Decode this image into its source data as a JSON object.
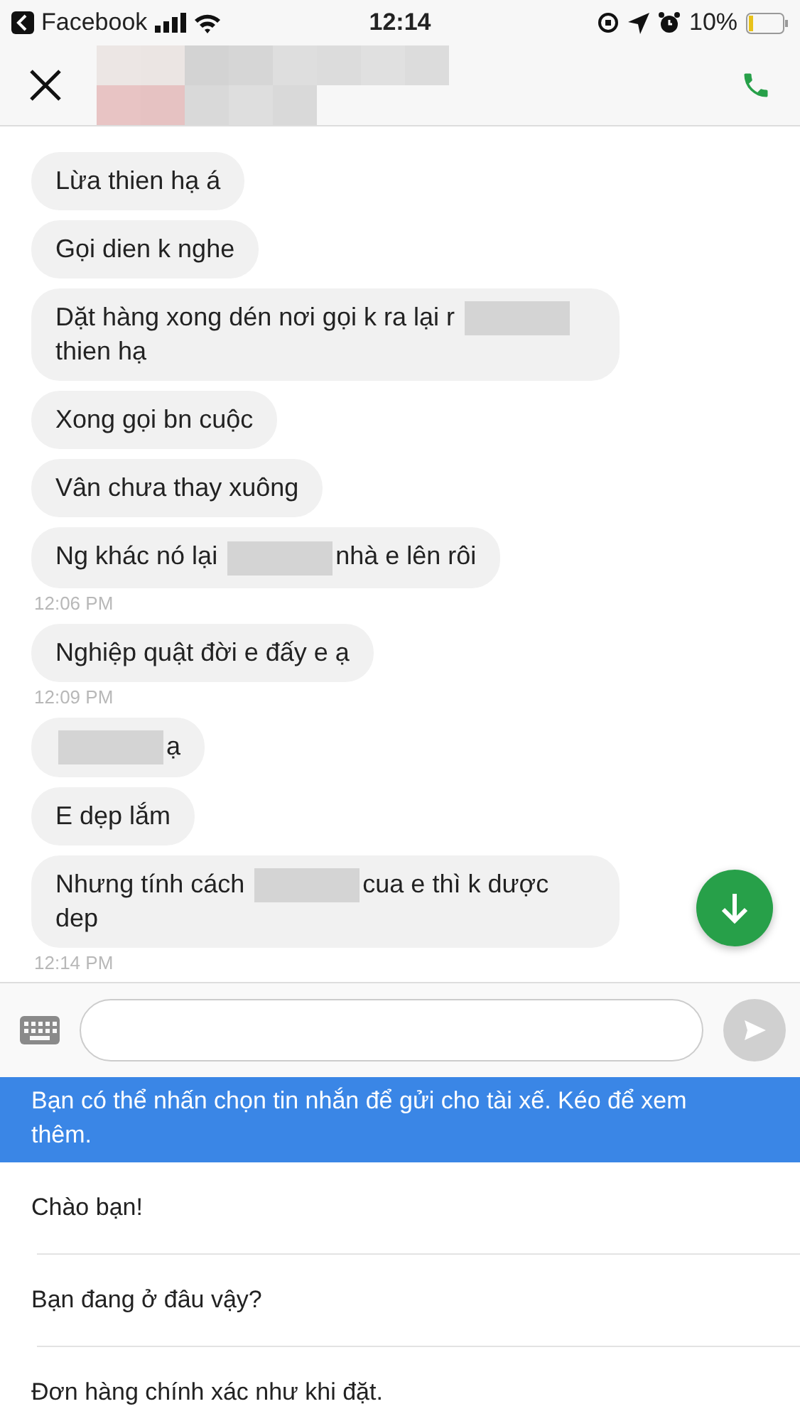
{
  "status_bar": {
    "back_app": "Facebook",
    "time": "12:14",
    "battery": "10%"
  },
  "messages": [
    {
      "kind": "message",
      "parts": [
        {
          "kind": "text",
          "text": "Lừa thien hạ á"
        }
      ]
    },
    {
      "kind": "message",
      "parts": [
        {
          "kind": "text",
          "text": "Gọi dien k nghe"
        }
      ]
    },
    {
      "kind": "message",
      "parts": [
        {
          "kind": "text",
          "text": "Dặt hàng xong dén nơi gọi k ra lại r"
        },
        {
          "kind": "redacted"
        },
        {
          "kind": "text",
          "text": "thien hạ"
        }
      ]
    },
    {
      "kind": "message",
      "parts": [
        {
          "kind": "text",
          "text": "Xong gọi bn cuộc"
        }
      ]
    },
    {
      "kind": "message",
      "parts": [
        {
          "kind": "text",
          "text": "Vân chưa thay xuông"
        }
      ]
    },
    {
      "kind": "message",
      "parts": [
        {
          "kind": "text",
          "text": "Ng khác nó lại"
        },
        {
          "kind": "redacted"
        },
        {
          "kind": "text",
          "text": "nhà e lên rôi"
        }
      ]
    },
    {
      "kind": "time",
      "text": "12:06 PM"
    },
    {
      "kind": "message",
      "parts": [
        {
          "kind": "text",
          "text": "Nghiệp quật đời e đấy e ạ"
        }
      ]
    },
    {
      "kind": "time",
      "text": "12:09 PM"
    },
    {
      "kind": "message",
      "parts": [
        {
          "kind": "redacted"
        },
        {
          "kind": "text",
          "text": "ạ"
        }
      ]
    },
    {
      "kind": "message",
      "parts": [
        {
          "kind": "text",
          "text": "E dẹp lắm"
        }
      ]
    },
    {
      "kind": "message",
      "parts": [
        {
          "kind": "text",
          "text": "Nhưng tính cách"
        },
        {
          "kind": "redacted"
        },
        {
          "kind": "text",
          "text": "cua e thì k dược dep"
        }
      ]
    },
    {
      "kind": "time",
      "text": "12:14 PM"
    }
  ],
  "hint_banner": "Bạn có thể nhấn chọn tin nhắn để gửi cho tài xế. Kéo để xem thêm.",
  "quick_replies": [
    "Chào bạn!",
    "Bạn đang ở đâu vậy?",
    "Đơn hàng chính xác như khi đặt."
  ]
}
